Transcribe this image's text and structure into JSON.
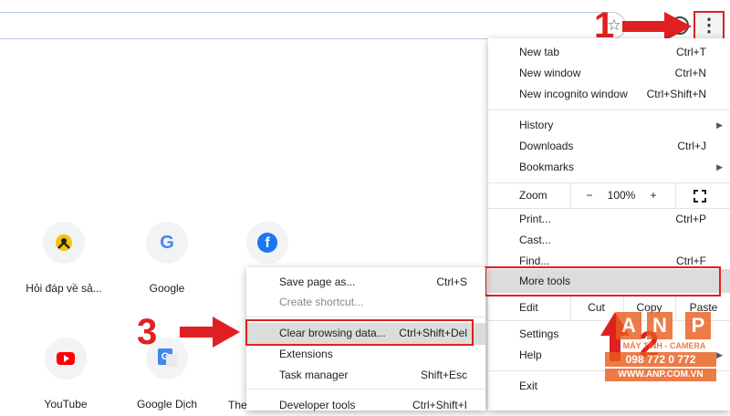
{
  "toolbar": {
    "star_glyph": "☆",
    "kebab_glyph": "⋮"
  },
  "annotations": {
    "step1": "1",
    "step2": "2",
    "step3": "3",
    "color": "#e02020"
  },
  "shortcuts": [
    {
      "label": "Hỏi đáp về sả...",
      "icon": "support-agent-icon"
    },
    {
      "label": "Google",
      "icon": "google-g-icon"
    },
    {
      "label": "YouTube",
      "icon": "youtube-icon"
    },
    {
      "label": "Google Dịch",
      "icon": "google-translate-icon"
    },
    {
      "label": "The",
      "icon": "partial-tile-icon"
    }
  ],
  "menu": {
    "new_tab": {
      "label": "New tab",
      "shortcut": "Ctrl+T"
    },
    "new_window": {
      "label": "New window",
      "shortcut": "Ctrl+N"
    },
    "new_incognito": {
      "label": "New incognito window",
      "shortcut": "Ctrl+Shift+N"
    },
    "history": {
      "label": "History"
    },
    "downloads": {
      "label": "Downloads",
      "shortcut": "Ctrl+J"
    },
    "bookmarks": {
      "label": "Bookmarks"
    },
    "zoom": {
      "label": "Zoom",
      "minus": "−",
      "value": "100%",
      "plus": "+"
    },
    "print": {
      "label": "Print...",
      "shortcut": "Ctrl+P"
    },
    "cast": {
      "label": "Cast..."
    },
    "find": {
      "label": "Find...",
      "shortcut": "Ctrl+F"
    },
    "more_tools": {
      "label": "More tools"
    },
    "edit": {
      "label": "Edit",
      "cut": "Cut",
      "copy": "Copy",
      "paste": "Paste"
    },
    "settings": {
      "label": "Settings"
    },
    "help": {
      "label": "Help"
    },
    "exit": {
      "label": "Exit"
    }
  },
  "submenu": {
    "save_page": {
      "label": "Save page as...",
      "shortcut": "Ctrl+S"
    },
    "create_shortcut": {
      "label": "Create shortcut..."
    },
    "clear_data": {
      "label": "Clear browsing data...",
      "shortcut": "Ctrl+Shift+Del"
    },
    "extensions": {
      "label": "Extensions"
    },
    "task_manager": {
      "label": "Task manager",
      "shortcut": "Shift+Esc"
    },
    "developer_tools": {
      "label": "Developer tools",
      "shortcut": "Ctrl+Shift+I"
    }
  },
  "watermark": {
    "logo_a": "A",
    "logo_n": "N",
    "logo_p": "P",
    "tagline": "MÁY TÍNH - CAMERA",
    "phone": "098 772 0 772",
    "site": "WWW.ANP.COM.VN"
  }
}
